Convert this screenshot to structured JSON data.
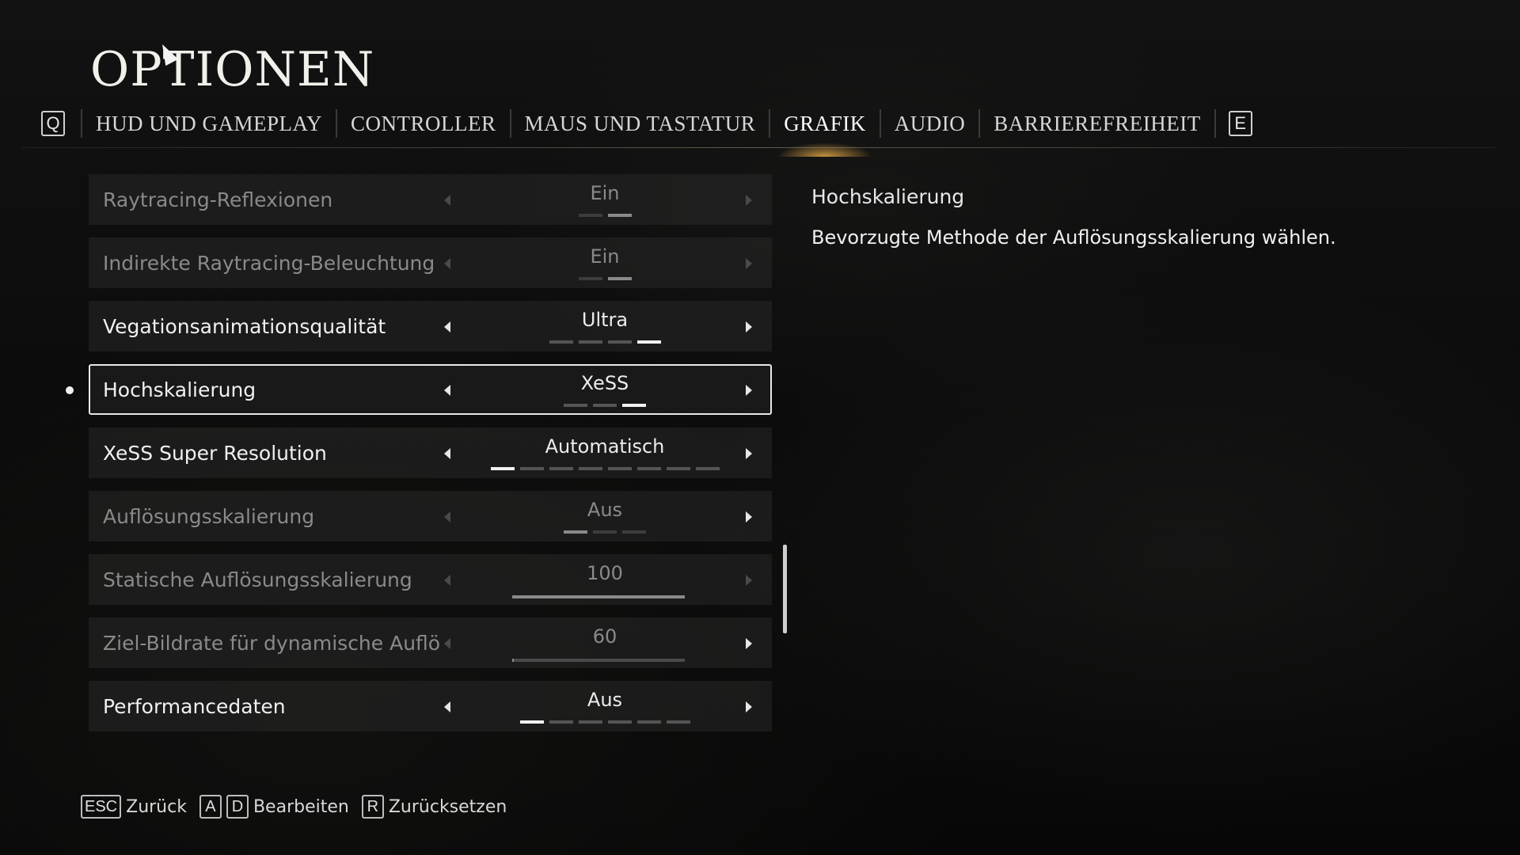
{
  "title": "OPTIONEN",
  "tabbar": {
    "prev_key": "Q",
    "next_key": "E",
    "tabs": [
      {
        "label": "HUD UND GAMEPLAY",
        "active": false
      },
      {
        "label": "CONTROLLER",
        "active": false
      },
      {
        "label": "MAUS UND TASTATUR",
        "active": false
      },
      {
        "label": "GRAFIK",
        "active": true
      },
      {
        "label": "AUDIO",
        "active": false
      },
      {
        "label": "BARRIEREFREIHEIT",
        "active": false
      }
    ]
  },
  "settings": [
    {
      "label": "Raytracing-Reflexionen",
      "value": "Ein",
      "segments": 2,
      "selected_index": 1,
      "enabled": false
    },
    {
      "label": "Indirekte Raytracing-Beleuchtung",
      "value": "Ein",
      "segments": 2,
      "selected_index": 1,
      "enabled": false
    },
    {
      "label": "Vegationsanimationsqualität",
      "value": "Ultra",
      "segments": 4,
      "selected_index": 3,
      "enabled": true
    },
    {
      "label": "Hochskalierung",
      "value": "XeSS",
      "segments": 3,
      "selected_index": 2,
      "enabled": true,
      "selected": true
    },
    {
      "label": "XeSS Super Resolution",
      "value": "Automatisch",
      "segments": 8,
      "selected_index": 0,
      "enabled": true
    },
    {
      "label": "Auflösungsskalierung",
      "value": "Aus",
      "segments": 3,
      "selected_index": 0,
      "enabled": false
    },
    {
      "label": "Statische Auflösungsskalierung",
      "value": "100",
      "slider": 1.0,
      "enabled": false
    },
    {
      "label": "Ziel-Bildrate für dynamische Auflö",
      "value": "60",
      "slider": 0.0,
      "enabled": false
    },
    {
      "label": "Performancedaten",
      "value": "Aus",
      "segments": 6,
      "selected_index": 0,
      "enabled": true
    }
  ],
  "description": {
    "title": "Hochskalierung",
    "text": "Bevorzugte Methode der Auflösungsskalierung wählen."
  },
  "footer": {
    "back_key": "ESC",
    "back_label": "Zurück",
    "edit_key_left": "A",
    "edit_key_right": "D",
    "edit_label": "Bearbeiten",
    "reset_key": "R",
    "reset_label": "Zurücksetzen"
  },
  "colors": {
    "accent_glow": "#e6aa46",
    "text": "#f0f0f0",
    "dim_text": "#8a8a8a"
  }
}
